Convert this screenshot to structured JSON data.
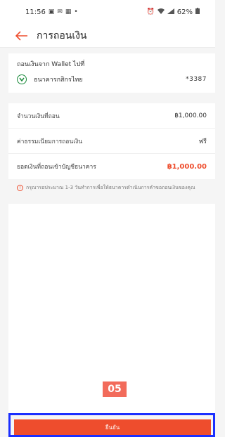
{
  "status_bar": {
    "time": "11:56",
    "left_icons": [
      "image-icon",
      "mail-icon",
      "notification-icon",
      "dot-icon"
    ],
    "right_icons": [
      "alarm-icon",
      "wifi-icon",
      "signal-icon"
    ],
    "battery": "62%"
  },
  "header": {
    "title": "การถอนเงิน"
  },
  "bank_section": {
    "label": "ถอนเงินจาก Wallet ไปที่",
    "bank_name": "ธนาคารกสิกรไทย",
    "account_no": "*3387"
  },
  "summary": {
    "rows": [
      {
        "label": "จำนวนเงินที่ถอน",
        "value": "฿1,000.00"
      },
      {
        "label": "ค่าธรรมเนียมการถอนเงิน",
        "value": "ฟรี"
      },
      {
        "label": "ยอดเงินที่ถอนเข้าบัญชีธนาคาร",
        "value": "฿1,000.00"
      }
    ]
  },
  "notice": "กรุณารอประมาณ 1-3 วันทำการเพื่อให้ธนาคารดำเนินการคำขอถอนเงินของคุณ",
  "annotation": {
    "step_label": "05"
  },
  "confirm_button": {
    "label": "ยืนยัน"
  },
  "colors": {
    "accent": "#ee4d2d",
    "annotation_box": "#1b2fff",
    "annotation_badge": "#f26b5b",
    "bank_logo": "#1b8a3b"
  }
}
